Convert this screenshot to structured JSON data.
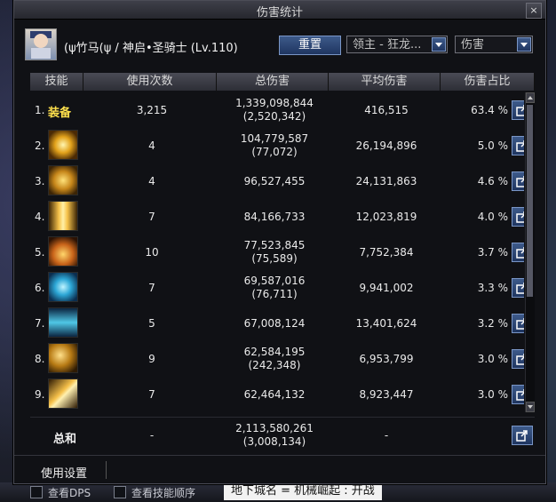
{
  "window": {
    "title": "伤害统计",
    "close_glyph": "×"
  },
  "header": {
    "character": "(ψ竹马(ψ / 神启•圣骑士 (Lv.110)",
    "reset_label": "重置",
    "target_dropdown": "领主 - 狂龙...",
    "mode_dropdown": "伤害"
  },
  "table": {
    "columns": [
      "技能",
      "使用次数",
      "总伤害",
      "平均伤害",
      "伤害占比"
    ],
    "rows": [
      {
        "rank": "1.",
        "skill": "装备",
        "uses": "3,215",
        "total": "1,339,098,844",
        "total_sub": "(2,520,342)",
        "avg": "416,515",
        "share": "63.4 %",
        "icon": "equipment-text"
      },
      {
        "rank": "2.",
        "skill": "",
        "uses": "4",
        "total": "104,779,587",
        "total_sub": "(77,072)",
        "avg": "26,194,896",
        "share": "5.0 %",
        "icon": "holy-burst-skill-icon"
      },
      {
        "rank": "3.",
        "skill": "",
        "uses": "4",
        "total": "96,527,455",
        "total_sub": "",
        "avg": "24,131,863",
        "share": "4.6 %",
        "icon": "golden-cross-skill-icon"
      },
      {
        "rank": "4.",
        "skill": "",
        "uses": "7",
        "total": "84,166,733",
        "total_sub": "",
        "avg": "12,023,819",
        "share": "4.0 %",
        "icon": "pillar-light-skill-icon"
      },
      {
        "rank": "5.",
        "skill": "",
        "uses": "10",
        "total": "77,523,845",
        "total_sub": "(75,589)",
        "avg": "7,752,384",
        "share": "3.7 %",
        "icon": "flame-wings-skill-icon"
      },
      {
        "rank": "6.",
        "skill": "",
        "uses": "7",
        "total": "69,587,016",
        "total_sub": "(76,711)",
        "avg": "9,941,002",
        "share": "3.3 %",
        "icon": "blue-orb-skill-icon"
      },
      {
        "rank": "7.",
        "skill": "",
        "uses": "5",
        "total": "67,008,124",
        "total_sub": "",
        "avg": "13,401,624",
        "share": "3.2 %",
        "icon": "ice-spikes-skill-icon"
      },
      {
        "rank": "8.",
        "skill": "",
        "uses": "9",
        "total": "62,584,195",
        "total_sub": "(242,348)",
        "avg": "6,953,799",
        "share": "3.0 %",
        "icon": "golden-hammer-skill-icon"
      },
      {
        "rank": "9.",
        "skill": "",
        "uses": "7",
        "total": "62,464,132",
        "total_sub": "",
        "avg": "8,923,447",
        "share": "3.0 %",
        "icon": "golden-blade-skill-icon"
      }
    ],
    "total": {
      "label": "总和",
      "uses": "-",
      "total": "2,113,580,261",
      "total_sub": "(3,008,134)",
      "avg": "-"
    }
  },
  "footer": {
    "settings_label": "使用设置"
  },
  "game_ui": {
    "show_dps": "查看DPS",
    "show_skill_order": "查看技能顺序",
    "dungeon": "地下城名 = 机械崛起 : 开战"
  },
  "colors": {
    "accent_blue": "#2d4a7a",
    "equip_yellow": "#ffe04d",
    "window_bg": "#101115"
  }
}
